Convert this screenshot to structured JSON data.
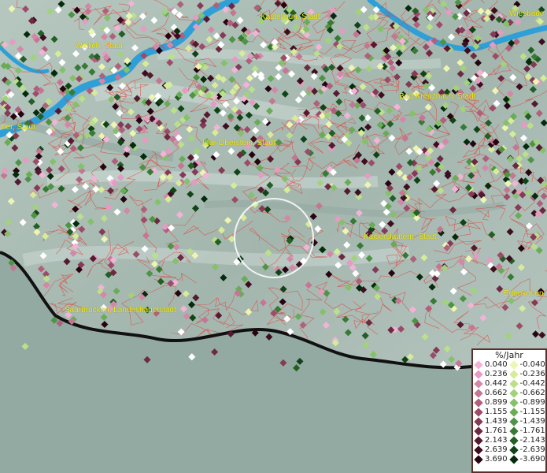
{
  "map": {
    "cities": [
      {
        "id": "kastellaun",
        "label": "Kastellaun, Stadt"
      },
      {
        "id": "wiesbaden",
        "label": "Wiesbade"
      },
      {
        "id": "wittlich",
        "label": "Wittlich, Stadt"
      },
      {
        "id": "bad-kreuznach",
        "label": "Bad Kreuznach, Stadt"
      },
      {
        "id": "trier",
        "label": "rier, Stadt"
      },
      {
        "id": "idar-oberstein",
        "label": "Idar-Oberstein, Stadt"
      },
      {
        "id": "kaiserslautern",
        "label": "Kaiserslautern, Stadt"
      },
      {
        "id": "edenkoben",
        "label": "Edenkoben"
      },
      {
        "id": "saarbruecken",
        "label": "Saarbrücken, Landeshauptstadt"
      }
    ],
    "colors": {
      "terrain": "#9fb3ad",
      "water": "#2f9fd8",
      "border": "#e0403a",
      "label": "#f2ee10",
      "focus_circle": "#ffffff"
    },
    "focus_marker": "circle"
  },
  "legend": {
    "title": "%/Jahr",
    "positive": [
      {
        "value": "0.040",
        "color": "#f2b3d6"
      },
      {
        "value": "0.236",
        "color": "#e59bc2"
      },
      {
        "value": "0.442",
        "color": "#d488a8"
      },
      {
        "value": "0.662",
        "color": "#c47693"
      },
      {
        "value": "0.899",
        "color": "#b0607c"
      },
      {
        "value": "1.155",
        "color": "#9c4c68"
      },
      {
        "value": "1.439",
        "color": "#853a55"
      },
      {
        "value": "1.761",
        "color": "#6e2942"
      },
      {
        "value": "2.143",
        "color": "#561a30"
      },
      {
        "value": "2.639",
        "color": "#3e0e1f"
      },
      {
        "value": "3.690",
        "color": "#260410"
      }
    ],
    "negative": [
      {
        "value": "-0.040",
        "color": "#eef5b0"
      },
      {
        "value": "-0.236",
        "color": "#d6ec98"
      },
      {
        "value": "-0.442",
        "color": "#bce08a"
      },
      {
        "value": "-0.662",
        "color": "#a2d27c"
      },
      {
        "value": "-0.899",
        "color": "#86c06b"
      },
      {
        "value": "-1.155",
        "color": "#6aab58"
      },
      {
        "value": "-1.439",
        "color": "#4f9445"
      },
      {
        "value": "-1.761",
        "color": "#367a33"
      },
      {
        "value": "-2.143",
        "color": "#215f24"
      },
      {
        "value": "-2.639",
        "color": "#104417"
      },
      {
        "value": "-3.690",
        "color": "#052a0c"
      }
    ]
  }
}
